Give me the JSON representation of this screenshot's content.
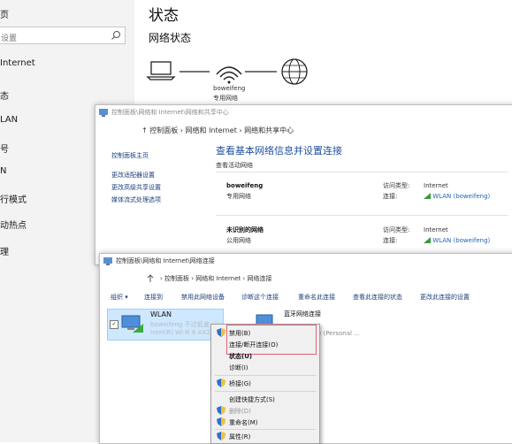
{
  "settings": {
    "nav_items": [
      "页",
      "",
      "Internet",
      "态",
      "LAN",
      "号",
      "N",
      "行模式",
      "动热点",
      "理"
    ],
    "search_placeholder": "设置",
    "page_title": "状态",
    "section_title": "网络状态",
    "network_name": "boweifeng",
    "network_type": "专用网络"
  },
  "nsc": {
    "title": "控制面板\\网络和 Internet\\网络和共享中心",
    "address": "↑  控制面板  ›  网络和 Internet  ›  网络和共享中心",
    "sidebar": [
      "控制面板主页",
      "更改适配器设置",
      "更改高级共享设置",
      "媒体流式处理选项"
    ],
    "heading": "查看基本网络信息并设置连接",
    "subheading": "查看活动网络",
    "networks": [
      {
        "name": "boweifeng",
        "type": "专用网络",
        "access_label": "访问类型:",
        "access_value": "Internet",
        "conn_label": "连接:",
        "conn_value": "WLAN (boweifeng)"
      },
      {
        "name": "未识别的网络",
        "type": "公用网络",
        "access_label": "访问类型:",
        "access_value": "Internet",
        "conn_label": "连接:",
        "conn_value": "WLAN (boweifeng)"
      }
    ]
  },
  "nc": {
    "title": "控制面板\\网络和 Internet\\网络连接",
    "address": "›  控制面板  ›  网络和 Internet  ›  网络连接",
    "toolbar": [
      "组织 ▾",
      "连接到",
      "禁用此网络设备",
      "诊断这个连接",
      "重命名此连接",
      "查看此连接的状态",
      "更改此连接的设置"
    ],
    "wlan": {
      "name": "WLAN",
      "status": "boweifeng 不过低速",
      "device": "Intel(R) Wi-Fi 6 AX2"
    },
    "bluetooth": {
      "name": "蓝牙网络连接",
      "device": "vice (Personal ..."
    }
  },
  "context_menu": {
    "items": [
      "禁用(B)",
      "连接/断开连接(O)",
      "状态(U)",
      "诊断(I)",
      "桥接(G)",
      "创建快捷方式(S)",
      "删除(D)",
      "重命名(M)",
      "属性(R)"
    ]
  },
  "colors": {
    "link": "#1f64b3",
    "highlight": "#e0607a",
    "selection": "#cde8ff"
  }
}
